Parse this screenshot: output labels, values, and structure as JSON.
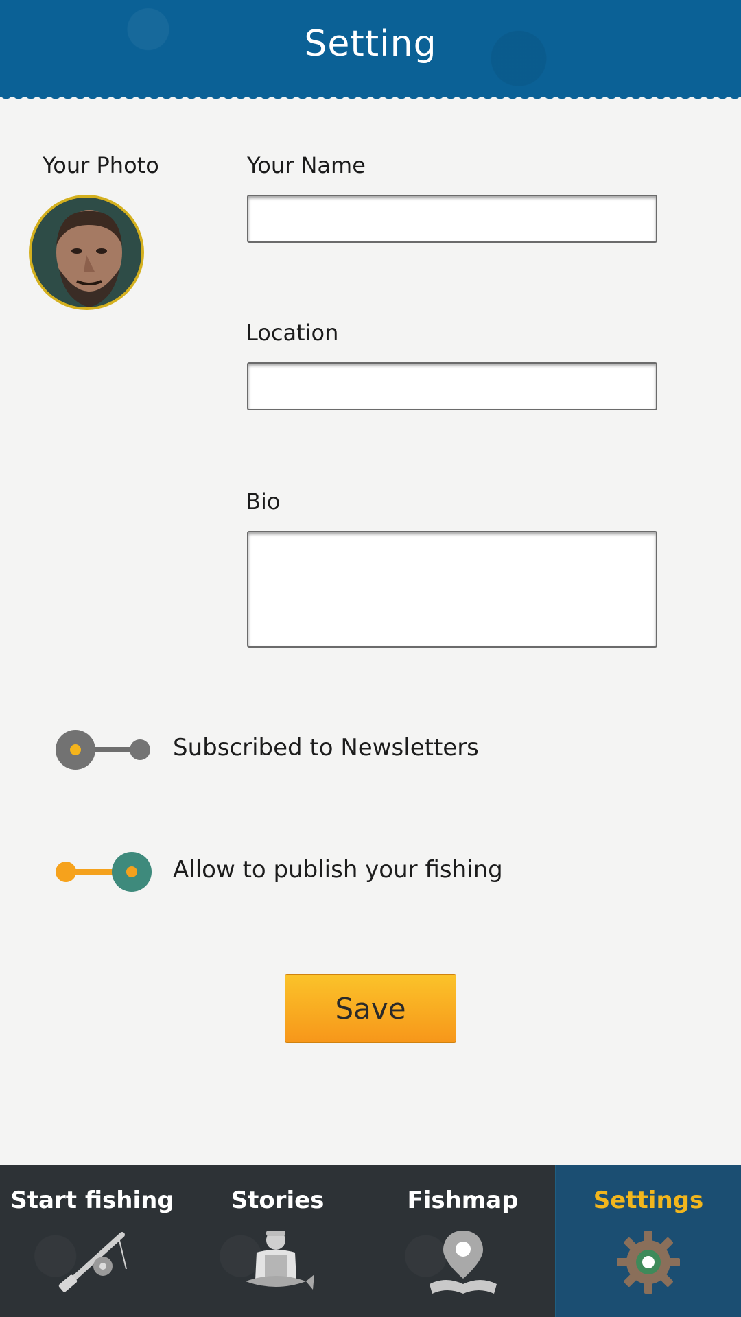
{
  "header": {
    "title": "Setting"
  },
  "profile": {
    "photo_label": "Your Photo",
    "name_label": "Your Name",
    "name_value": "",
    "location_label": "Location",
    "location_value": "",
    "bio_label": "Bio",
    "bio_value": ""
  },
  "toggles": [
    {
      "label": "Subscribed to Newsletters",
      "on": false
    },
    {
      "label": "Allow to publish your fishing",
      "on": true
    }
  ],
  "save_label": "Save",
  "nav": {
    "items": [
      {
        "label": "Start fishing",
        "icon": "fishing-rod-icon"
      },
      {
        "label": "Stories",
        "icon": "fisherman-icon"
      },
      {
        "label": "Fishmap",
        "icon": "map-pin-icon"
      },
      {
        "label": "Settings",
        "icon": "gear-icon",
        "active": true
      }
    ]
  },
  "colors": {
    "header": "#0b6196",
    "accent": "#f2b61d",
    "toggle_on": "#3d8a7c",
    "nav_bg": "#2d3236",
    "nav_active": "#1b4e72"
  }
}
